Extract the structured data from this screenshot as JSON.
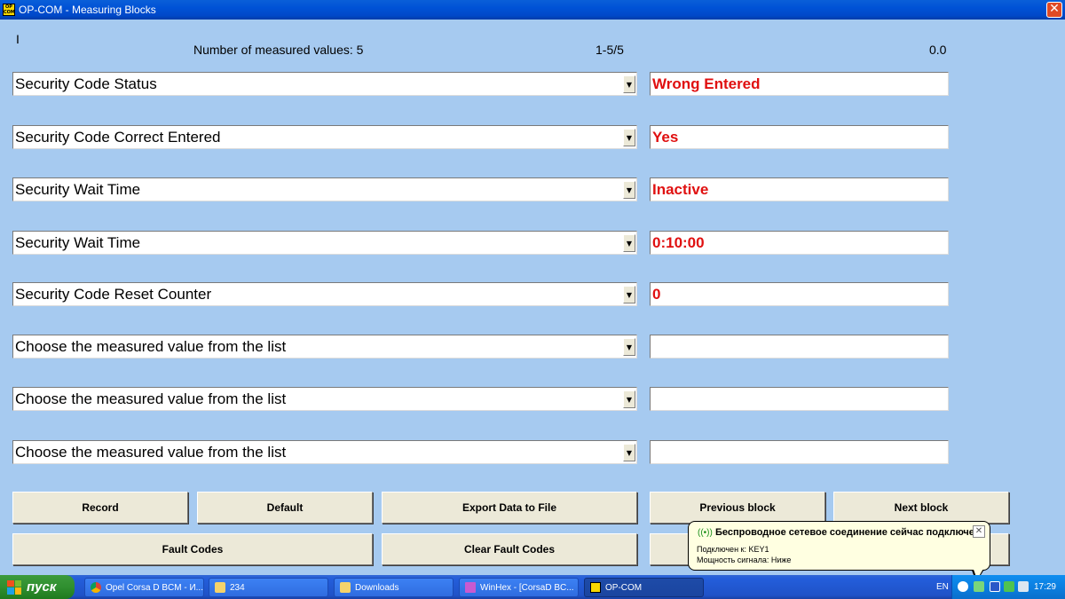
{
  "window": {
    "title": "OP-COM - Measuring Blocks",
    "app_icon_text": "OP COM"
  },
  "header": {
    "cursor": "I",
    "count_label": "Number of measured values: 5",
    "range": "1-5/5",
    "time": "0.0"
  },
  "rows": [
    {
      "label": "Security Code Status",
      "value": "Wrong Entered"
    },
    {
      "label": "Security Code Correct Entered",
      "value": "Yes"
    },
    {
      "label": "Security Wait Time",
      "value": "Inactive"
    },
    {
      "label": "Security Wait Time",
      "value": "0:10:00"
    },
    {
      "label": "Security Code Reset Counter",
      "value": "0"
    },
    {
      "label": "Choose the measured value from the list",
      "value": ""
    },
    {
      "label": "Choose the measured value from the list",
      "value": ""
    },
    {
      "label": "Choose the measured value from the list",
      "value": ""
    }
  ],
  "buttons": {
    "record": "Record",
    "default": "Default",
    "export": "Export Data to File",
    "previous": "Previous block",
    "next": "Next block",
    "fault_codes": "Fault Codes",
    "clear_fault_codes": "Clear Fault Codes"
  },
  "notification": {
    "title": "Беспроводное сетевое соединение сейчас подключен",
    "line1": "Подключен к: KEY1",
    "line2": "Мощность сигнала: Ниже"
  },
  "taskbar": {
    "start_label": "пуск",
    "tasks": [
      {
        "label": "Opel Corsa D BCM - И..."
      },
      {
        "label": "234"
      },
      {
        "label": "Downloads"
      },
      {
        "label": "WinHex - [CorsaD BC..."
      },
      {
        "label": "OP-COM"
      }
    ],
    "language": "EN",
    "clock": "17:29"
  },
  "colors": {
    "background": "#a6caf0",
    "value_text": "#e01010",
    "button_face": "#ece9d8"
  }
}
